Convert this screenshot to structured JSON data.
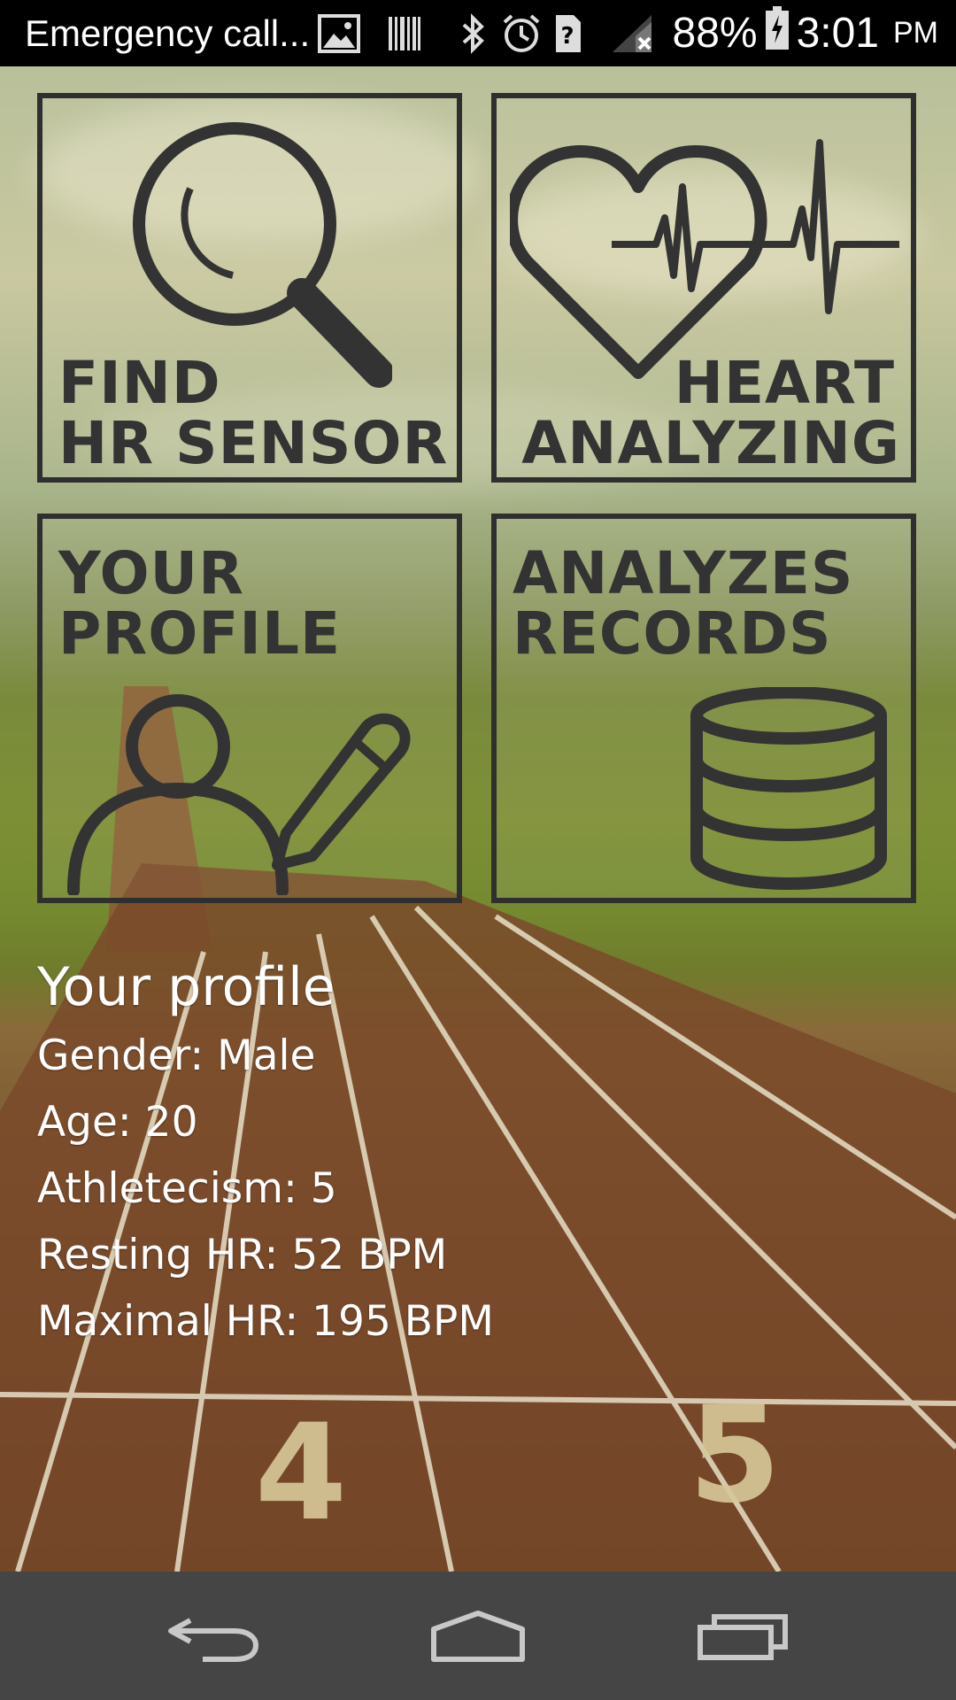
{
  "status_bar": {
    "notification_text": "Emergency call...",
    "battery_percent": "88%",
    "time": "3:01",
    "ampm": "PM",
    "icons": [
      "image-icon",
      "barcode-icon",
      "bluetooth-icon",
      "alarm-icon",
      "unknown-sim-icon",
      "signal-icon",
      "battery-charging-icon"
    ]
  },
  "tiles": {
    "find": {
      "line1": "FIND",
      "line2": "HR SENSOR",
      "icon": "magnifier-icon"
    },
    "heart": {
      "line1": "HEART",
      "line2": "ANALYZING",
      "icon": "heart-pulse-icon"
    },
    "profile": {
      "line1": "YOUR",
      "line2": "PROFILE",
      "icon": "user-edit-icon"
    },
    "records": {
      "line1": "ANALYZES",
      "line2": "RECORDS",
      "icon": "database-icon"
    }
  },
  "profile": {
    "title": "Your profile",
    "gender": "Gender: Male",
    "age": "Age: 20",
    "athleticism": "Athletecism: 5",
    "resting_hr": "Resting HR: 52 BPM",
    "maximal_hr": "Maximal HR: 195 BPM"
  },
  "background": {
    "lane_numbers": [
      "4",
      "5"
    ]
  },
  "nav_bar": {
    "icons": [
      "back-icon",
      "home-icon",
      "recent-apps-icon"
    ]
  },
  "colors": {
    "tile_border": "#2f2f2f",
    "tile_text": "#333333",
    "navbar": "#454545",
    "status_bar": "#000000"
  }
}
